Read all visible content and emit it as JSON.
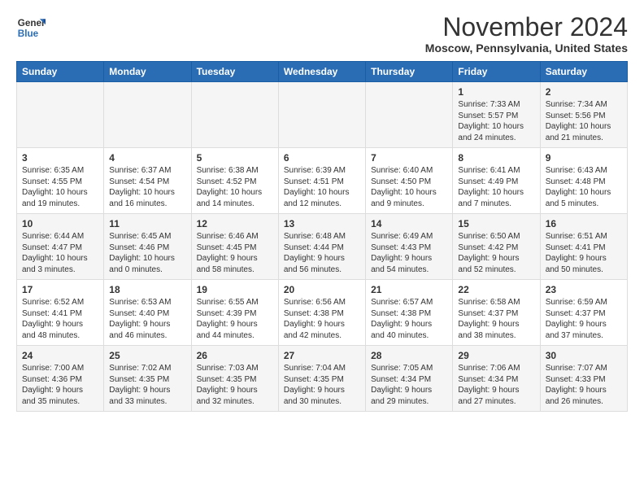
{
  "logo": {
    "general": "General",
    "blue": "Blue"
  },
  "header": {
    "month": "November 2024",
    "location": "Moscow, Pennsylvania, United States"
  },
  "weekdays": [
    "Sunday",
    "Monday",
    "Tuesday",
    "Wednesday",
    "Thursday",
    "Friday",
    "Saturday"
  ],
  "weeks": [
    [
      {
        "day": "",
        "info": ""
      },
      {
        "day": "",
        "info": ""
      },
      {
        "day": "",
        "info": ""
      },
      {
        "day": "",
        "info": ""
      },
      {
        "day": "",
        "info": ""
      },
      {
        "day": "1",
        "info": "Sunrise: 7:33 AM\nSunset: 5:57 PM\nDaylight: 10 hours and 24 minutes."
      },
      {
        "day": "2",
        "info": "Sunrise: 7:34 AM\nSunset: 5:56 PM\nDaylight: 10 hours and 21 minutes."
      }
    ],
    [
      {
        "day": "3",
        "info": "Sunrise: 6:35 AM\nSunset: 4:55 PM\nDaylight: 10 hours and 19 minutes."
      },
      {
        "day": "4",
        "info": "Sunrise: 6:37 AM\nSunset: 4:54 PM\nDaylight: 10 hours and 16 minutes."
      },
      {
        "day": "5",
        "info": "Sunrise: 6:38 AM\nSunset: 4:52 PM\nDaylight: 10 hours and 14 minutes."
      },
      {
        "day": "6",
        "info": "Sunrise: 6:39 AM\nSunset: 4:51 PM\nDaylight: 10 hours and 12 minutes."
      },
      {
        "day": "7",
        "info": "Sunrise: 6:40 AM\nSunset: 4:50 PM\nDaylight: 10 hours and 9 minutes."
      },
      {
        "day": "8",
        "info": "Sunrise: 6:41 AM\nSunset: 4:49 PM\nDaylight: 10 hours and 7 minutes."
      },
      {
        "day": "9",
        "info": "Sunrise: 6:43 AM\nSunset: 4:48 PM\nDaylight: 10 hours and 5 minutes."
      }
    ],
    [
      {
        "day": "10",
        "info": "Sunrise: 6:44 AM\nSunset: 4:47 PM\nDaylight: 10 hours and 3 minutes."
      },
      {
        "day": "11",
        "info": "Sunrise: 6:45 AM\nSunset: 4:46 PM\nDaylight: 10 hours and 0 minutes."
      },
      {
        "day": "12",
        "info": "Sunrise: 6:46 AM\nSunset: 4:45 PM\nDaylight: 9 hours and 58 minutes."
      },
      {
        "day": "13",
        "info": "Sunrise: 6:48 AM\nSunset: 4:44 PM\nDaylight: 9 hours and 56 minutes."
      },
      {
        "day": "14",
        "info": "Sunrise: 6:49 AM\nSunset: 4:43 PM\nDaylight: 9 hours and 54 minutes."
      },
      {
        "day": "15",
        "info": "Sunrise: 6:50 AM\nSunset: 4:42 PM\nDaylight: 9 hours and 52 minutes."
      },
      {
        "day": "16",
        "info": "Sunrise: 6:51 AM\nSunset: 4:41 PM\nDaylight: 9 hours and 50 minutes."
      }
    ],
    [
      {
        "day": "17",
        "info": "Sunrise: 6:52 AM\nSunset: 4:41 PM\nDaylight: 9 hours and 48 minutes."
      },
      {
        "day": "18",
        "info": "Sunrise: 6:53 AM\nSunset: 4:40 PM\nDaylight: 9 hours and 46 minutes."
      },
      {
        "day": "19",
        "info": "Sunrise: 6:55 AM\nSunset: 4:39 PM\nDaylight: 9 hours and 44 minutes."
      },
      {
        "day": "20",
        "info": "Sunrise: 6:56 AM\nSunset: 4:38 PM\nDaylight: 9 hours and 42 minutes."
      },
      {
        "day": "21",
        "info": "Sunrise: 6:57 AM\nSunset: 4:38 PM\nDaylight: 9 hours and 40 minutes."
      },
      {
        "day": "22",
        "info": "Sunrise: 6:58 AM\nSunset: 4:37 PM\nDaylight: 9 hours and 38 minutes."
      },
      {
        "day": "23",
        "info": "Sunrise: 6:59 AM\nSunset: 4:37 PM\nDaylight: 9 hours and 37 minutes."
      }
    ],
    [
      {
        "day": "24",
        "info": "Sunrise: 7:00 AM\nSunset: 4:36 PM\nDaylight: 9 hours and 35 minutes."
      },
      {
        "day": "25",
        "info": "Sunrise: 7:02 AM\nSunset: 4:35 PM\nDaylight: 9 hours and 33 minutes."
      },
      {
        "day": "26",
        "info": "Sunrise: 7:03 AM\nSunset: 4:35 PM\nDaylight: 9 hours and 32 minutes."
      },
      {
        "day": "27",
        "info": "Sunrise: 7:04 AM\nSunset: 4:35 PM\nDaylight: 9 hours and 30 minutes."
      },
      {
        "day": "28",
        "info": "Sunrise: 7:05 AM\nSunset: 4:34 PM\nDaylight: 9 hours and 29 minutes."
      },
      {
        "day": "29",
        "info": "Sunrise: 7:06 AM\nSunset: 4:34 PM\nDaylight: 9 hours and 27 minutes."
      },
      {
        "day": "30",
        "info": "Sunrise: 7:07 AM\nSunset: 4:33 PM\nDaylight: 9 hours and 26 minutes."
      }
    ]
  ]
}
